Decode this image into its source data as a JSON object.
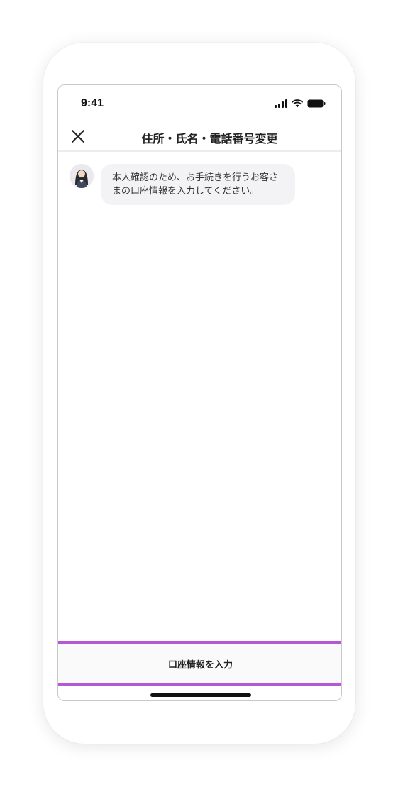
{
  "status_bar": {
    "time": "9:41"
  },
  "nav": {
    "title": "住所・氏名・電話番号変更"
  },
  "chat": {
    "message": "本人確認のため、お手続きを行うお客さまの口座情報を入力してください。"
  },
  "cta": {
    "label": "口座情報を入力",
    "highlight_color": "#b657d3"
  },
  "icons": {
    "close": "close-icon",
    "signal": "signal-icon",
    "wifi": "wifi-icon",
    "battery": "battery-icon",
    "avatar": "avatar"
  }
}
